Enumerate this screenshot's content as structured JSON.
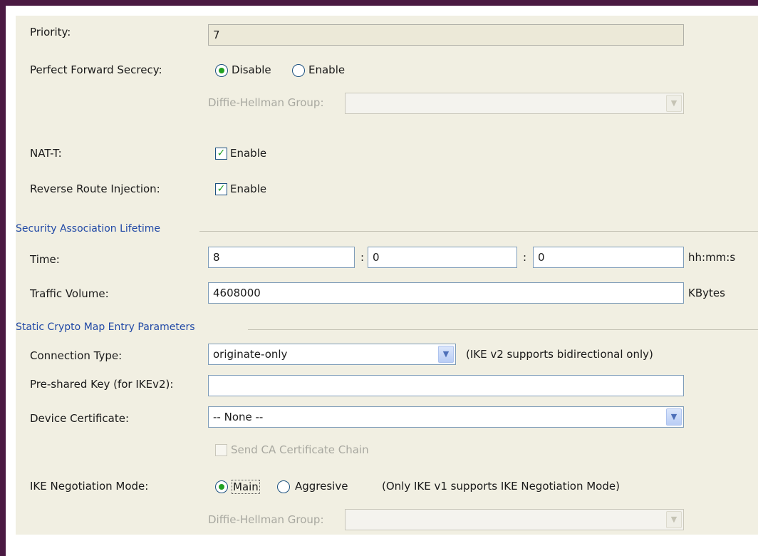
{
  "general": {
    "priority_label": "Priority:",
    "priority_value": "7",
    "pfs_label": "Perfect Forward Secrecy:",
    "pfs_disable": "Disable",
    "pfs_enable": "Enable",
    "pfs_selected": "Disable",
    "dh_group_label": "Diffie-Hellman Group:",
    "dh_group_value": "",
    "natt_label": "NAT-T:",
    "natt_enable": "Enable",
    "natt_checked": true,
    "rri_label": "Reverse Route Injection:",
    "rri_enable": "Enable",
    "rri_checked": true
  },
  "lifetime": {
    "title": "Security Association Lifetime",
    "time_label": "Time:",
    "hours": "8",
    "minutes": "0",
    "seconds": "0",
    "separator": ":",
    "time_unit": "hh:mm:s",
    "traffic_label": "Traffic Volume:",
    "traffic_value": "4608000",
    "traffic_unit": "KBytes"
  },
  "crypto_map": {
    "title": "Static Crypto Map Entry Parameters",
    "connection_type_label": "Connection Type:",
    "connection_type_value": "originate-only",
    "connection_type_note": "(IKE v2 supports bidirectional only)",
    "psk_label": "Pre-shared Key (for IKEv2):",
    "psk_value": "",
    "device_cert_label": "Device Certificate:",
    "device_cert_value": "-- None --",
    "send_ca_chain_label": "Send CA Certificate Chain",
    "send_ca_chain_checked": false,
    "ike_mode_label": "IKE Negotiation Mode:",
    "ike_mode_main": "Main",
    "ike_mode_aggressive": "Aggresive",
    "ike_mode_selected": "Main",
    "ike_mode_note": "(Only IKE v1 supports IKE Negotiation Mode)",
    "dh_group_label": "Diffie-Hellman Group:",
    "dh_group_value": ""
  },
  "icons": {
    "dropdown": "chevron-down-icon",
    "check": "checkmark-icon"
  },
  "colors": {
    "frame": "#4a1942",
    "panel": "#f1efe2",
    "section_title": "#2149a6",
    "radio_dot": "#21a121"
  }
}
